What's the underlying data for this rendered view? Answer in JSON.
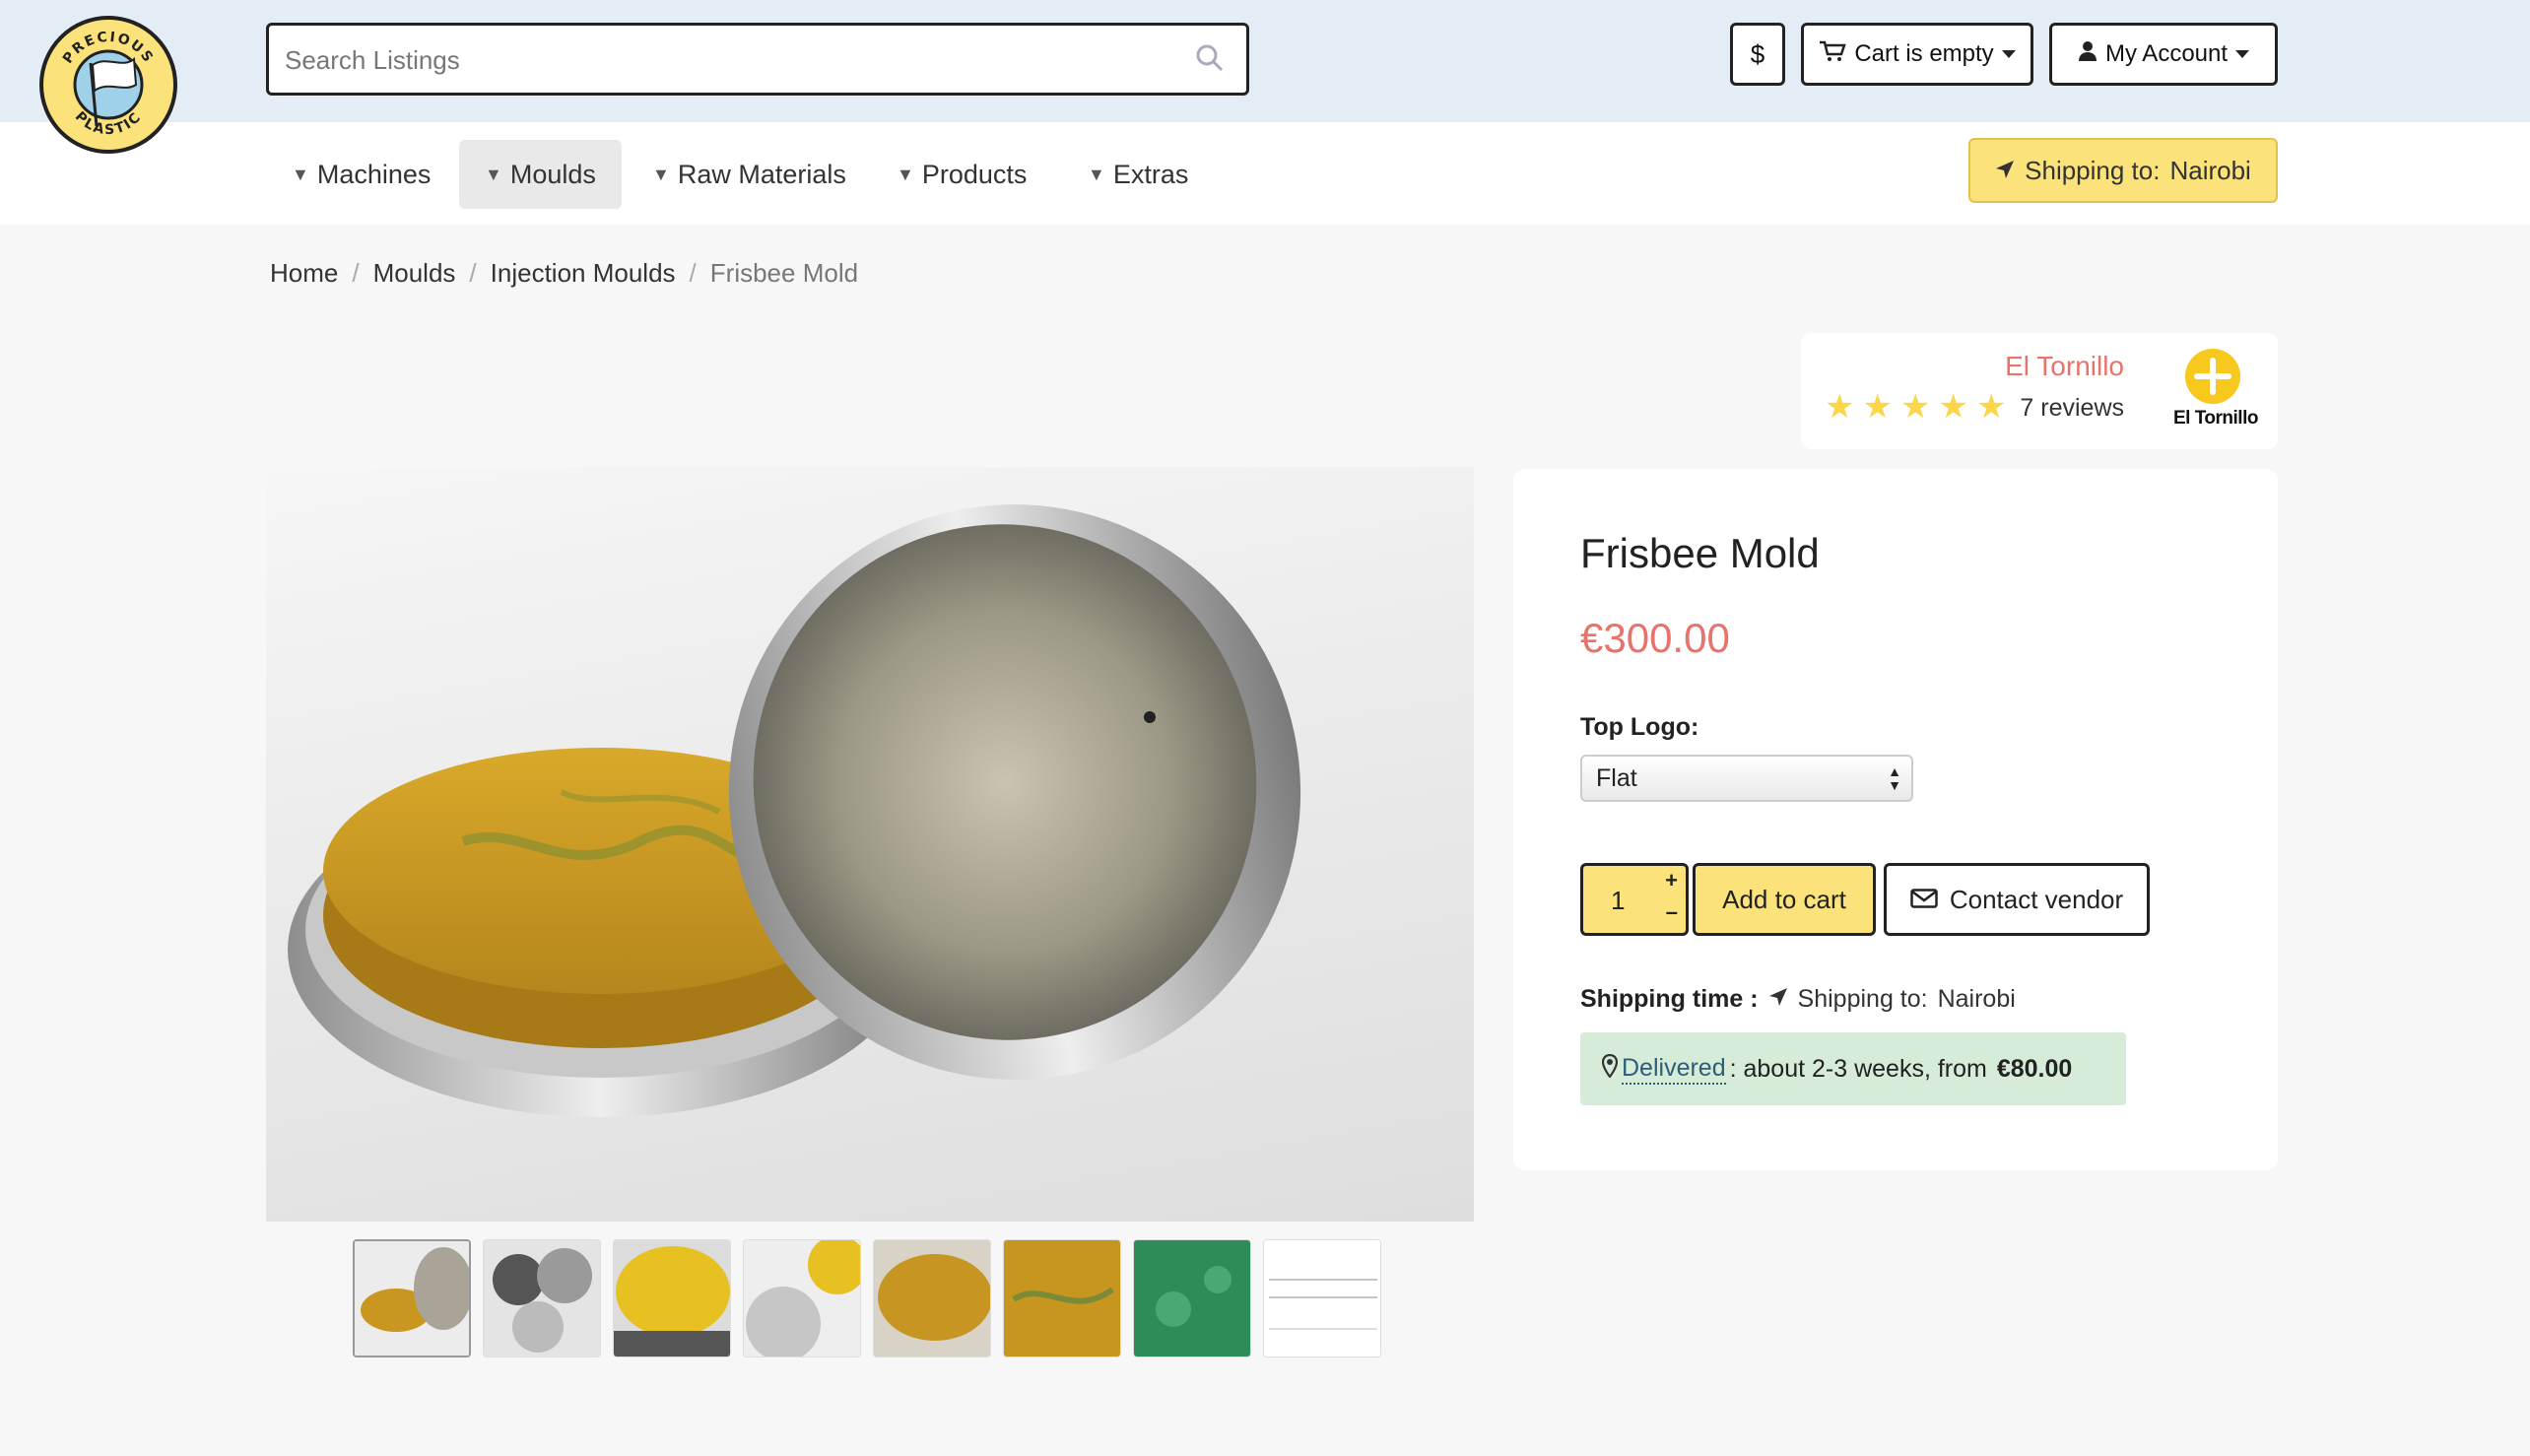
{
  "header": {
    "logo_text_top": "PRECIOUS",
    "logo_text_bottom": "PLASTIC",
    "search_placeholder": "Search Listings",
    "currency_label": "$",
    "cart_label": "Cart is empty",
    "account_label": "My Account"
  },
  "nav": {
    "items": [
      {
        "label": "Machines"
      },
      {
        "label": "Moulds"
      },
      {
        "label": "Raw Materials"
      },
      {
        "label": "Products"
      },
      {
        "label": "Extras"
      }
    ],
    "active": "Moulds",
    "shipping_prefix": "Shipping to:",
    "shipping_city": "Nairobi"
  },
  "breadcrumb": {
    "items": [
      "Home",
      "Moulds",
      "Injection Moulds"
    ],
    "separator": "/",
    "current": "Frisbee Mold"
  },
  "vendor": {
    "name": "El Tornillo",
    "rating": 5,
    "reviews": "7 reviews",
    "logo_caption": "El Tornillo"
  },
  "product": {
    "title": "Frisbee Mold",
    "price": "€300.00",
    "option_label": "Top Logo:",
    "option_value": "Flat",
    "quantity": "1",
    "add_to_cart_label": "Add to cart",
    "contact_label": "Contact vendor",
    "shipping_time_label": "Shipping time :",
    "shipping_prefix": "Shipping to:",
    "shipping_city": "Nairobi",
    "delivered_link": "Delivered",
    "delivered_text": ": about 2-3 weeks, from",
    "delivered_price": "€80.00"
  },
  "thumbnail_count": 8,
  "colors": {
    "topbar_bg": "#e4ecf5",
    "accent_yellow": "#fbe27a",
    "price_red": "#e8736b",
    "delivered_bg": "#d6ecd8"
  }
}
